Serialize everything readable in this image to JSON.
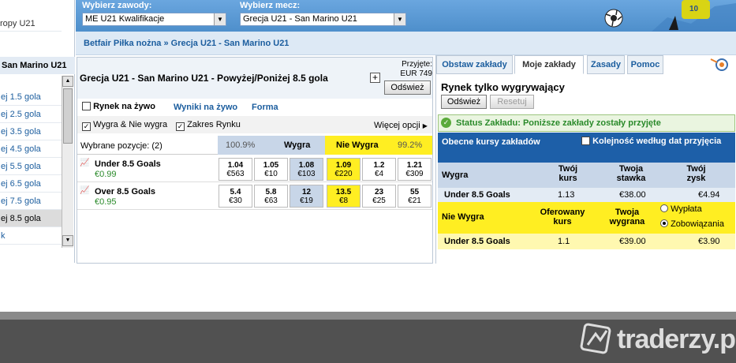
{
  "top": {
    "competition_label": "Wybierz zawody:",
    "competition_value": "ME U21 Kwalifikacje",
    "match_label": "Wybierz mecz:",
    "match_value": "Grecja U21 - San Marino U21"
  },
  "breadcrumb": "Betfair Piłka nożna » Grecja U21 - San Marino U21",
  "left": {
    "top_fragment": "ropy U21",
    "header": "San Marino U21",
    "items": [
      "ej 1.5 gola",
      "ej 2.5 gola",
      "ej 3.5 gola",
      "ej 4.5 gola",
      "ej 5.5 gola",
      "ej 6.5 gola",
      "ej 7.5 gola",
      "ej 8.5 gola",
      "k"
    ]
  },
  "center": {
    "title": "Grecja U21 - San Marino U21 - Powyżej/Poniżej 8.5 gola",
    "matched_label": "Przyjęte:",
    "matched_value": "EUR 749",
    "refresh": "Odśwież",
    "inplay": "Rynek na żywo",
    "results_link": "Wyniki na żywo",
    "form_link": "Forma",
    "opt_win_lose": "Wygra & Nie wygra",
    "opt_range": "Zakres Rynku",
    "more_options": "Więcej opcji",
    "selected": "Wybrane pozycje:  (2)",
    "back_pct": "100.9%",
    "back_label": "Wygra",
    "lay_label": "Nie Wygra",
    "lay_pct": "99.2%",
    "runners": [
      {
        "name": "Under 8.5 Goals",
        "pl": "€0.99",
        "prices": [
          [
            "1.04",
            "€563"
          ],
          [
            "1.05",
            "€10"
          ],
          [
            "1.08",
            "€103"
          ],
          [
            "1.09",
            "€220"
          ],
          [
            "1.2",
            "€4"
          ],
          [
            "1.21",
            "€309"
          ]
        ]
      },
      {
        "name": "Over 8.5 Goals",
        "pl": "€0.95",
        "prices": [
          [
            "5.4",
            "€30"
          ],
          [
            "5.8",
            "€63"
          ],
          [
            "12",
            "€19"
          ],
          [
            "13.5",
            "€8"
          ],
          [
            "23",
            "€25"
          ],
          [
            "55",
            "€21"
          ]
        ]
      }
    ]
  },
  "right": {
    "tabs": [
      "Obstaw zakłady",
      "Moje zakłady",
      "Zasady",
      "Pomoc"
    ],
    "market_type": "Rynek tylko wygrywający",
    "refresh": "Odśwież",
    "reset": "Resetuj",
    "status": "Status Zakładu: Poniższe zakłady zostały przyjęte",
    "current_odds": "Obecne kursy zakładów",
    "order_by_date": "Kolejność według dat przyjęcia",
    "back_head": {
      "col1": "Wygra",
      "col2": "Twój kurs",
      "col3": "Twoja stawka",
      "col4": "Twój zysk"
    },
    "back_row": {
      "name": "Under 8.5 Goals",
      "odds": "1.13",
      "stake": "€38.00",
      "profit": "€4.94"
    },
    "lay_head": {
      "col1": "Nie Wygra",
      "col2": "Oferowany kurs",
      "col3": "Twoja wygrana",
      "payout": "Wypłata",
      "liability": "Zobowiązania"
    },
    "lay_row": {
      "name": "Under 8.5 Goals",
      "odds": "1.1",
      "win": "€39.00",
      "liability": "€3.90"
    }
  },
  "watermark": "traderzy.pl",
  "colors": {
    "top_blue": "#5b9bd5",
    "back_blue": "#c8d6e8",
    "lay_yellow": "#ffee22",
    "link": "#1b5d9e",
    "status_green": "#2a8a2a"
  }
}
